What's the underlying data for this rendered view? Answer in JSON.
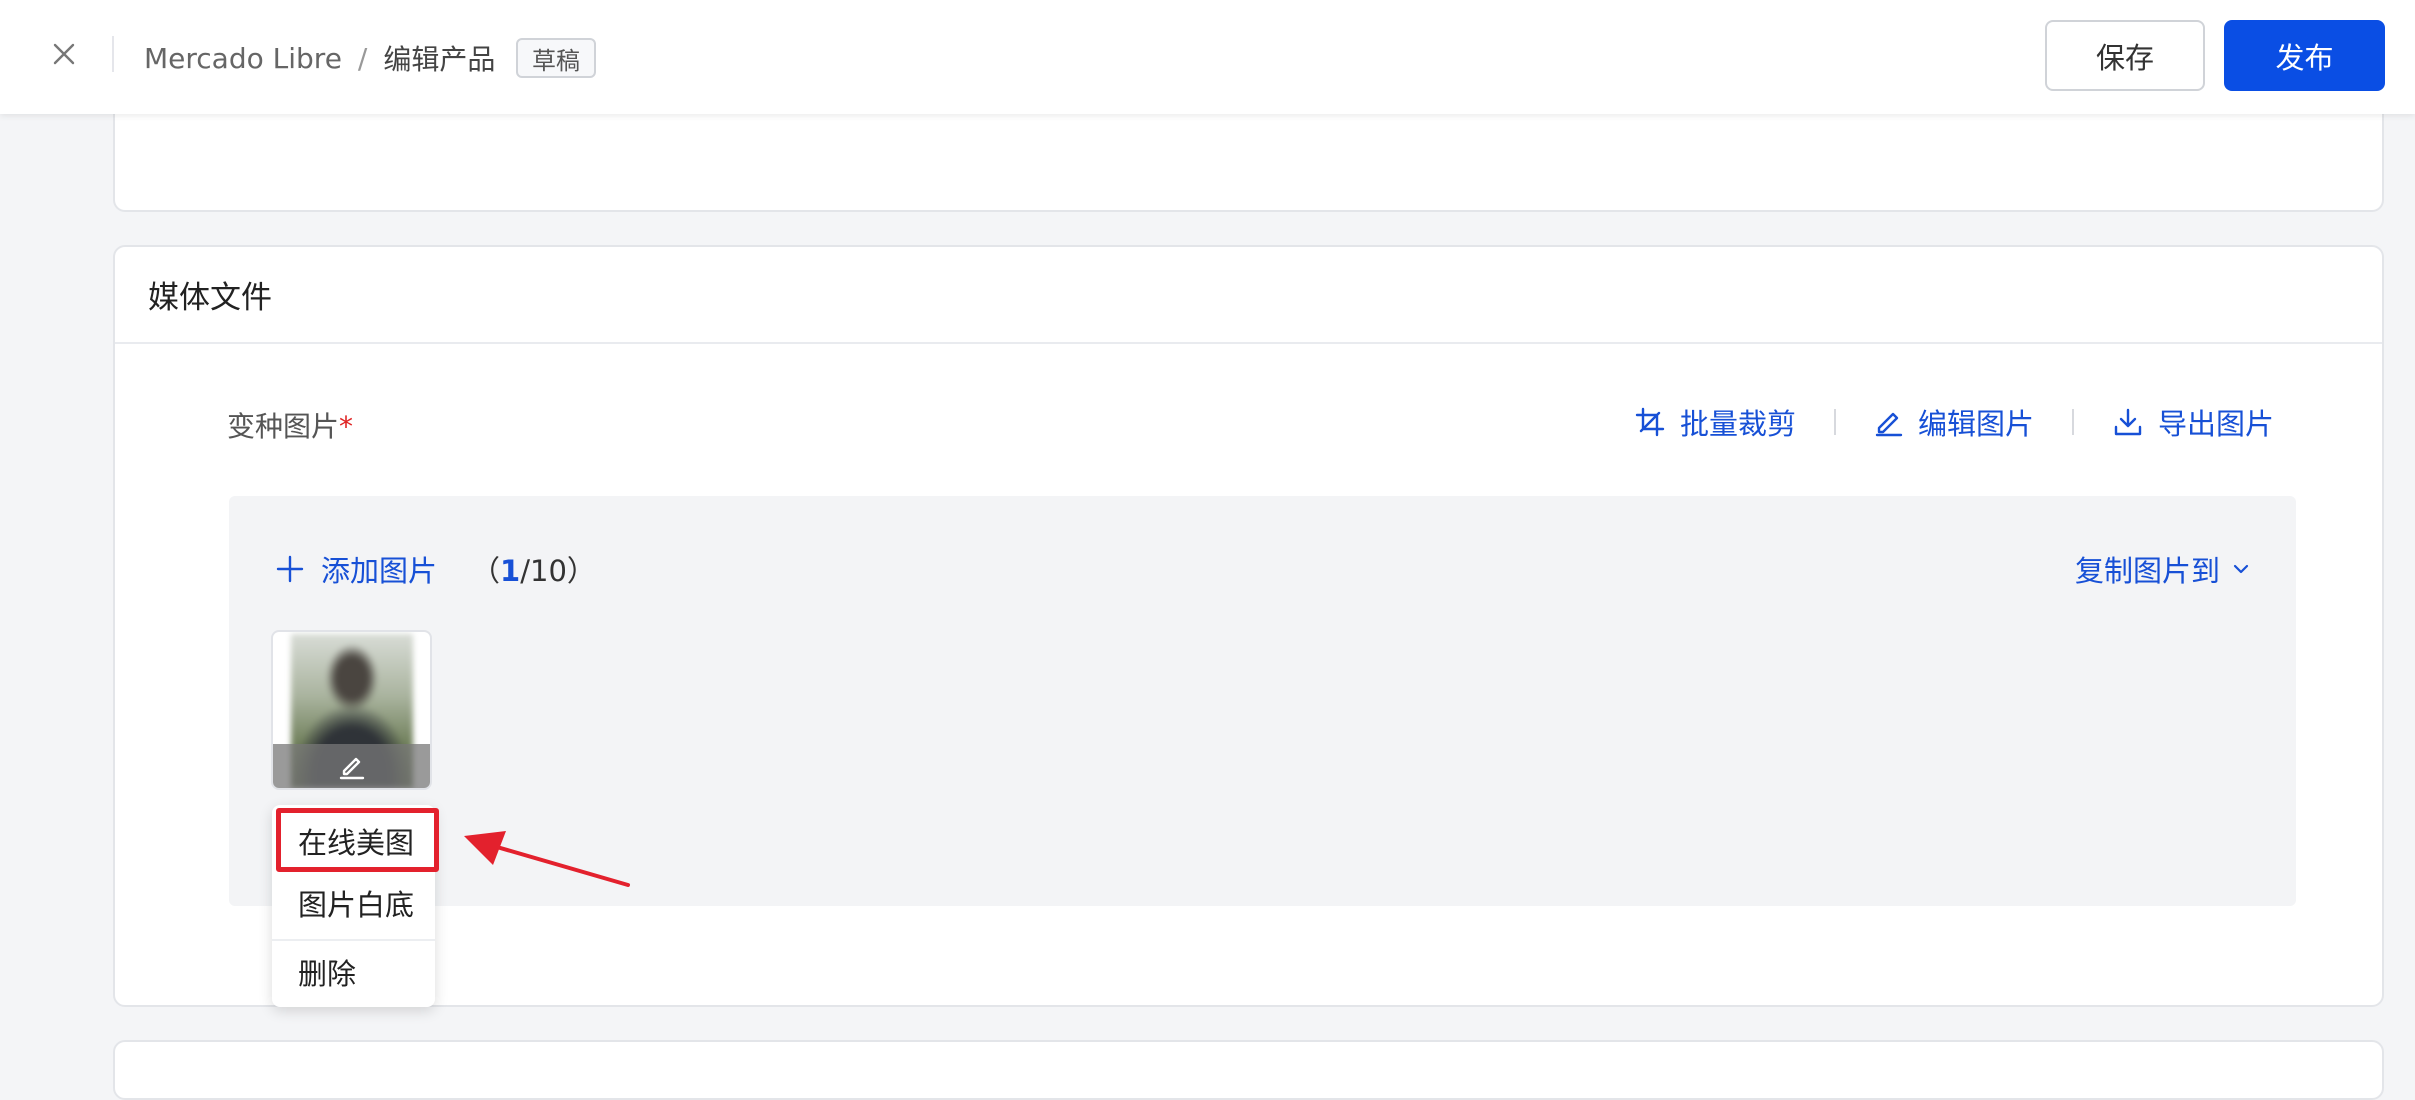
{
  "header": {
    "breadcrumb_root": "Mercado Libre",
    "breadcrumb_separator": "/",
    "breadcrumb_current": "编辑产品",
    "status_badge": "草稿",
    "save_label": "保存",
    "publish_label": "发布"
  },
  "media_section": {
    "title": "媒体文件",
    "variant_images_label": "变种图片",
    "required_mark": "*",
    "tools": {
      "batch_crop": "批量裁剪",
      "edit_images": "编辑图片",
      "export_images": "导出图片"
    },
    "add_image_label": "添加图片",
    "counter_open": "（",
    "counter_current": "1",
    "counter_rest": "/10）",
    "copy_to_label": "复制图片到"
  },
  "image_menu": {
    "items": [
      "在线美图",
      "图片白底",
      "删除"
    ]
  },
  "colors": {
    "primary": "#0a4ee4",
    "link": "#1750d6",
    "annotation": "#e3212d"
  },
  "icons": [
    "close-icon",
    "crop-icon",
    "pencil-icon",
    "download-icon",
    "plus-icon",
    "chevron-down-icon"
  ]
}
